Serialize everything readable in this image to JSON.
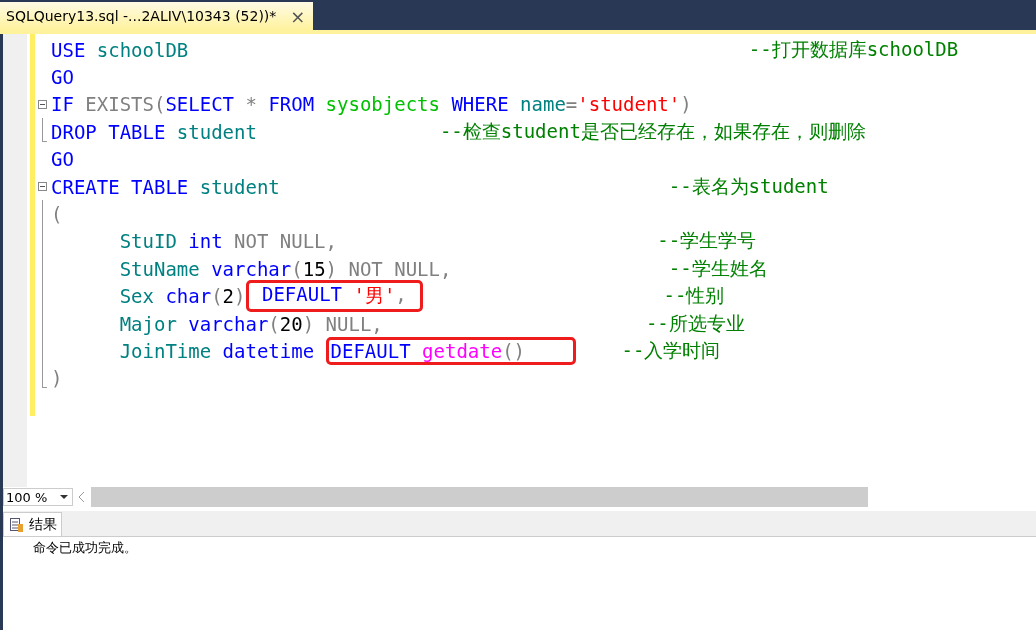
{
  "tab": {
    "title": "SQLQuery13.sql -...2ALIV\\10343 (52))*",
    "close": "×",
    "selected": true
  },
  "editor": {
    "lines": [
      {
        "kind": "plain",
        "tokens": [
          {
            "kind": "keyword",
            "text": "USE"
          },
          {
            "kind": "ident",
            "text": " schoolDB"
          },
          {
            "kind": "comment",
            "text": "                                                 --打开数据库schoolDB"
          }
        ]
      },
      {
        "kind": "plain",
        "tokens": [
          {
            "kind": "keyword",
            "text": "GO"
          }
        ]
      },
      {
        "kind": "foldstart",
        "tokens": [
          {
            "kind": "keyword",
            "text": "IF"
          },
          {
            "kind": "gray",
            "text": " EXISTS("
          },
          {
            "kind": "keyword",
            "text": "SELECT"
          },
          {
            "kind": "gray",
            "text": " *"
          },
          {
            "kind": "keyword",
            "text": " FROM"
          },
          {
            "kind": "system",
            "text": " sysobjects"
          },
          {
            "kind": "keyword",
            "text": " WHERE"
          },
          {
            "kind": "ident",
            "text": " name"
          },
          {
            "kind": "gray",
            "text": "="
          },
          {
            "kind": "string",
            "text": "'student'"
          },
          {
            "kind": "gray",
            "text": ")"
          }
        ]
      },
      {
        "kind": "foldend",
        "tokens": [
          {
            "kind": "keyword",
            "text": "DROP TABLE"
          },
          {
            "kind": "ident",
            "text": " student"
          },
          {
            "kind": "comment",
            "text": "                --检查student是否已经存在，如果存在，则删除"
          }
        ]
      },
      {
        "kind": "plain",
        "tokens": [
          {
            "kind": "keyword",
            "text": "GO"
          }
        ]
      },
      {
        "kind": "foldstart",
        "tokens": [
          {
            "kind": "keyword",
            "text": "CREATE TABLE"
          },
          {
            "kind": "ident",
            "text": " student"
          },
          {
            "kind": "comment",
            "text": "                                  --表名为student"
          }
        ]
      },
      {
        "kind": "foldbody",
        "tokens": [
          {
            "kind": "gray",
            "text": "("
          }
        ]
      },
      {
        "kind": "foldbody",
        "tokens": [
          {
            "kind": "ident",
            "text": "      StuID"
          },
          {
            "kind": "keyword",
            "text": " int"
          },
          {
            "kind": "gray",
            "text": " NOT NULL,"
          },
          {
            "kind": "comment",
            "text": "                            --学生学号"
          }
        ]
      },
      {
        "kind": "foldbody",
        "tokens": [
          {
            "kind": "ident",
            "text": "      StuName"
          },
          {
            "kind": "keyword",
            "text": " varchar"
          },
          {
            "kind": "gray",
            "text": "("
          },
          {
            "kind": "plain",
            "text": "15"
          },
          {
            "kind": "gray",
            "text": ") NOT NULL,"
          },
          {
            "kind": "comment",
            "text": "                   --学生姓名"
          }
        ]
      },
      {
        "kind": "foldbody",
        "tokens": [
          {
            "kind": "ident",
            "text": "      Sex"
          },
          {
            "kind": "keyword",
            "text": " char"
          },
          {
            "kind": "gray",
            "text": "("
          },
          {
            "kind": "plain",
            "text": "2"
          },
          {
            "kind": "gray",
            "text": ")"
          },
          {
            "kind": "keyword",
            "text": " DEFAULT",
            "boxed": true
          },
          {
            "kind": "string",
            "text": " '男'",
            "boxed": true
          },
          {
            "kind": "gray",
            "text": ", ",
            "boxed": true
          },
          {
            "kind": "comment",
            "text": "                     --性别"
          }
        ]
      },
      {
        "kind": "foldbody",
        "tokens": [
          {
            "kind": "ident",
            "text": "      Major"
          },
          {
            "kind": "keyword",
            "text": " varchar"
          },
          {
            "kind": "gray",
            "text": "("
          },
          {
            "kind": "plain",
            "text": "20"
          },
          {
            "kind": "gray",
            "text": ") NULL,"
          },
          {
            "kind": "comment",
            "text": "                       --所选专业"
          }
        ]
      },
      {
        "kind": "foldbody",
        "tokens": [
          {
            "kind": "ident",
            "text": "      JoinTime"
          },
          {
            "kind": "keyword",
            "text": " datetime "
          },
          {
            "kind": "keyword",
            "text": "DEFAULT",
            "boxed": true
          },
          {
            "kind": "func",
            "text": " getdate",
            "boxed": true
          },
          {
            "kind": "gray",
            "text": "()    ",
            "boxed": true
          },
          {
            "kind": "comment",
            "text": "    --入学时间"
          }
        ]
      },
      {
        "kind": "foldend",
        "tokens": [
          {
            "kind": "gray",
            "text": ")"
          }
        ]
      }
    ]
  },
  "zoom": {
    "value": "100 %"
  },
  "results": {
    "tabs": [
      {
        "label": "结果",
        "selected": true
      }
    ],
    "message": "命令已成功完成。"
  }
}
